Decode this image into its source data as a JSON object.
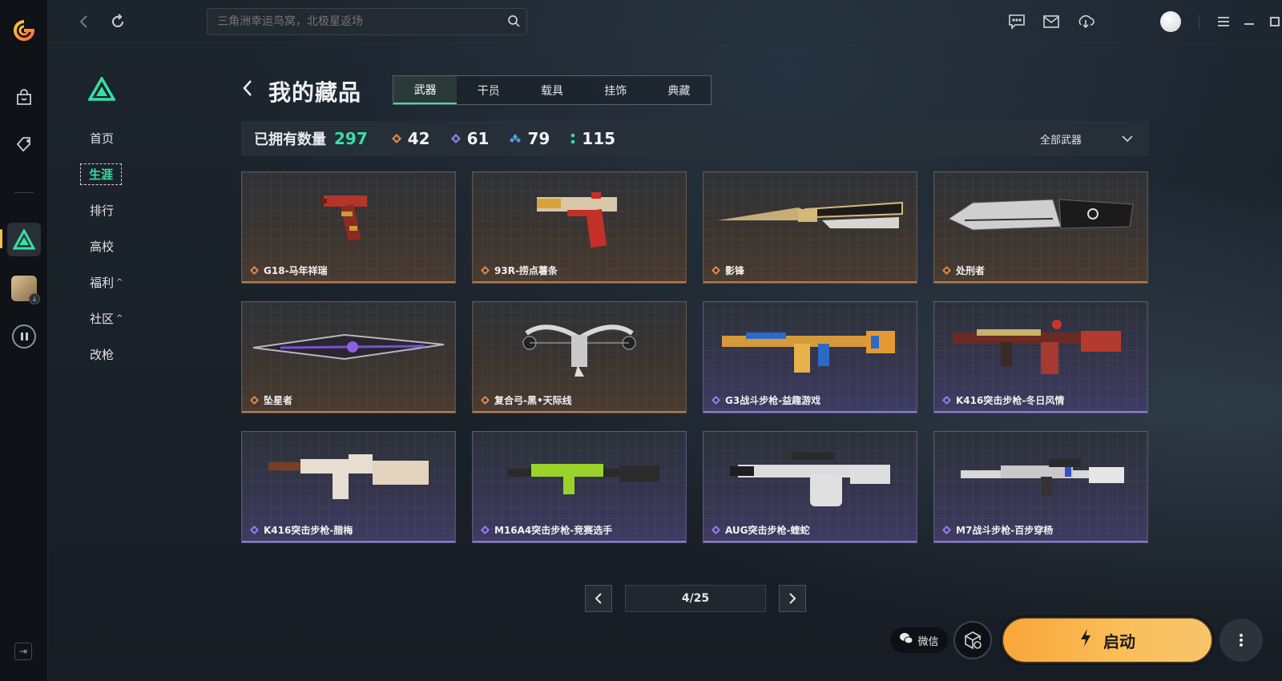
{
  "search": {
    "placeholder": "三角洲幸运鸟窝，北极星返场"
  },
  "sidebar": {
    "items": [
      {
        "label": "首页"
      },
      {
        "label": "生涯",
        "active": true
      },
      {
        "label": "排行"
      },
      {
        "label": "高校"
      },
      {
        "label": "福利",
        "caret": "^"
      },
      {
        "label": "社区",
        "caret": "^"
      },
      {
        "label": "改枪"
      }
    ]
  },
  "page": {
    "title": "我的藏品"
  },
  "tabs": [
    {
      "label": "武器",
      "active": true
    },
    {
      "label": "干员"
    },
    {
      "label": "载具"
    },
    {
      "label": "挂饰"
    },
    {
      "label": "典藏"
    }
  ],
  "stats": {
    "owned_label": "已拥有数量",
    "owned_count": "297",
    "tiers": [
      {
        "icon": "orange-diamond-icon",
        "color": "#e08a4a",
        "count": "42"
      },
      {
        "icon": "purple-diamond-icon",
        "color": "#9b7cf0",
        "count": "61"
      },
      {
        "icon": "blue-diamond-icon",
        "color": "#4aa6e8",
        "count": "79"
      },
      {
        "icon": "green-dots-icon",
        "color": "#35e0a1",
        "count": "115"
      }
    ],
    "filter_label": "全部武器"
  },
  "items": [
    {
      "name": "G18-马年祥瑞",
      "rarity": "orange"
    },
    {
      "name": "93R-捞点薯条",
      "rarity": "orange"
    },
    {
      "name": "影锋",
      "rarity": "orange"
    },
    {
      "name": "处刑者",
      "rarity": "orange"
    },
    {
      "name": "坠星者",
      "rarity": "orange"
    },
    {
      "name": "复合弓-黑•天际线",
      "rarity": "orange"
    },
    {
      "name": "G3战斗步枪-益趣游戏",
      "rarity": "purple"
    },
    {
      "name": "K416突击步枪-冬日风情",
      "rarity": "purple"
    },
    {
      "name": "K416突击步枪-腊梅",
      "rarity": "purple"
    },
    {
      "name": "M16A4突击步枪-竞赛选手",
      "rarity": "purple"
    },
    {
      "name": "AUG突击步枪-蝰蛇",
      "rarity": "purple"
    },
    {
      "name": "M7战斗步枪-百步穿杨",
      "rarity": "purple"
    }
  ],
  "pagination": {
    "label": "4/25",
    "current": 4,
    "total": 25
  },
  "bottom": {
    "wechat_label": "微信",
    "launch_label": "启动"
  },
  "colors": {
    "accent": "#35e0a1",
    "launch": "#f9a63a",
    "orange_rarity": "#e08a4a",
    "purple_rarity": "#9b7cf0"
  }
}
